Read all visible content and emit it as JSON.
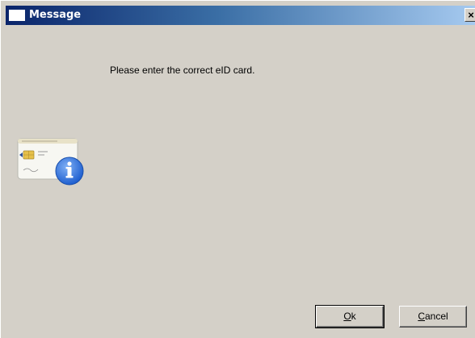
{
  "window": {
    "title": "Message",
    "close_glyph": "✕"
  },
  "message": {
    "text": "Please enter the correct eID card."
  },
  "icon": {
    "name": "eid-card-info-icon",
    "accent_color": "#2f6fd6"
  },
  "buttons": {
    "ok": {
      "mnemonic": "O",
      "rest": "k"
    },
    "cancel": {
      "mnemonic": "C",
      "rest": "ancel"
    }
  },
  "colors": {
    "dialog_background": "#d4d0c8",
    "titlebar_start": "#0a246a",
    "titlebar_end": "#a6caf0"
  }
}
